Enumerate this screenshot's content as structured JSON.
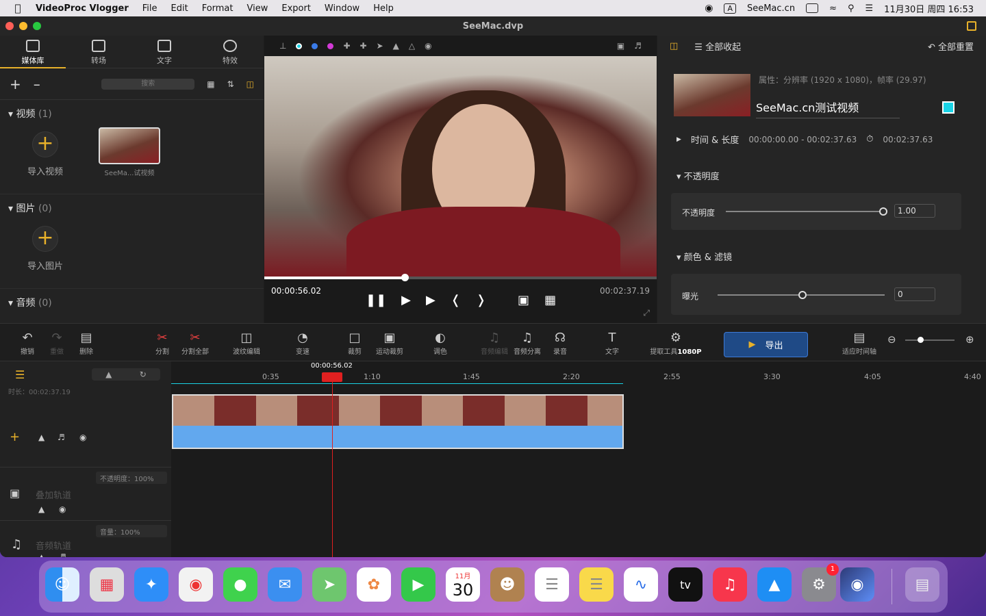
{
  "menubar": {
    "app_name": "VideoProc Vlogger",
    "items": [
      "File",
      "Edit",
      "Format",
      "View",
      "Export",
      "Window",
      "Help"
    ],
    "site": "SeeMac.cn",
    "clock": "11月30日 周四  16:53"
  },
  "window": {
    "title": "SeeMac.dvp"
  },
  "library": {
    "tabs": [
      {
        "label": "媒体库"
      },
      {
        "label": "转场"
      },
      {
        "label": "文字"
      },
      {
        "label": "特效"
      }
    ],
    "search_placeholder": "搜索",
    "sections": {
      "video": {
        "title": "视频",
        "count": "(1)",
        "import": "导入视频",
        "clip_caption": "SeeMa...试视频"
      },
      "image": {
        "title": "图片",
        "count": "(0)",
        "import": "导入图片"
      },
      "audio": {
        "title": "音频",
        "count": "(0)"
      }
    }
  },
  "preview": {
    "current_time": "00:00:56.02",
    "total_time": "00:02:37.19",
    "progress_fraction": 0.357
  },
  "inspector": {
    "collapse_all": "全部收起",
    "reset_all": "全部重置",
    "attributes": "属性：分辨率 (1920 x 1080)，帧率 (29.97)",
    "clip_name": "SeeMac.cn测试视频",
    "time_length": {
      "label": "时间 & 长度",
      "range": "00:00:00.00 - 00:02:37.63",
      "duration": "00:02:37.63"
    },
    "opacity": {
      "section": "不透明度",
      "label": "不透明度",
      "value": "1.00"
    },
    "color": {
      "section": "颜色 & 滤镜",
      "exposure_label": "曝光",
      "exposure_value": "0"
    }
  },
  "toolbar": {
    "undo": "撤销",
    "redo": "重做",
    "delete": "删除",
    "split": "分割",
    "split_all": "分割全部",
    "ripple": "波纹编辑",
    "speed": "变速",
    "crop": "裁剪",
    "motion_crop": "运动裁剪",
    "color_grade": "调色",
    "audio_edit": "音频编辑",
    "audio_separate": "音频分离",
    "record": "录音",
    "text": "文字",
    "extract": "提取工具",
    "resolution": "1080P",
    "export": "导出",
    "fit_timeline": "适应时间轴"
  },
  "timeline": {
    "playhead_time": "00:00:56.02",
    "duration_label": "时长：00:02:37.19",
    "ticks": [
      "0:35",
      "1:10",
      "1:45",
      "2:20",
      "2:55",
      "3:30",
      "4:05",
      "4:40"
    ],
    "overlay_track": "叠加轨道",
    "overlay_opacity": "不透明度：100%",
    "audio_track": "音频轨道",
    "audio_volume": "音量：100%"
  },
  "dock": {
    "calendar_month": "11月",
    "calendar_day": "30",
    "settings_badge": "1",
    "tv_label": "tv"
  }
}
